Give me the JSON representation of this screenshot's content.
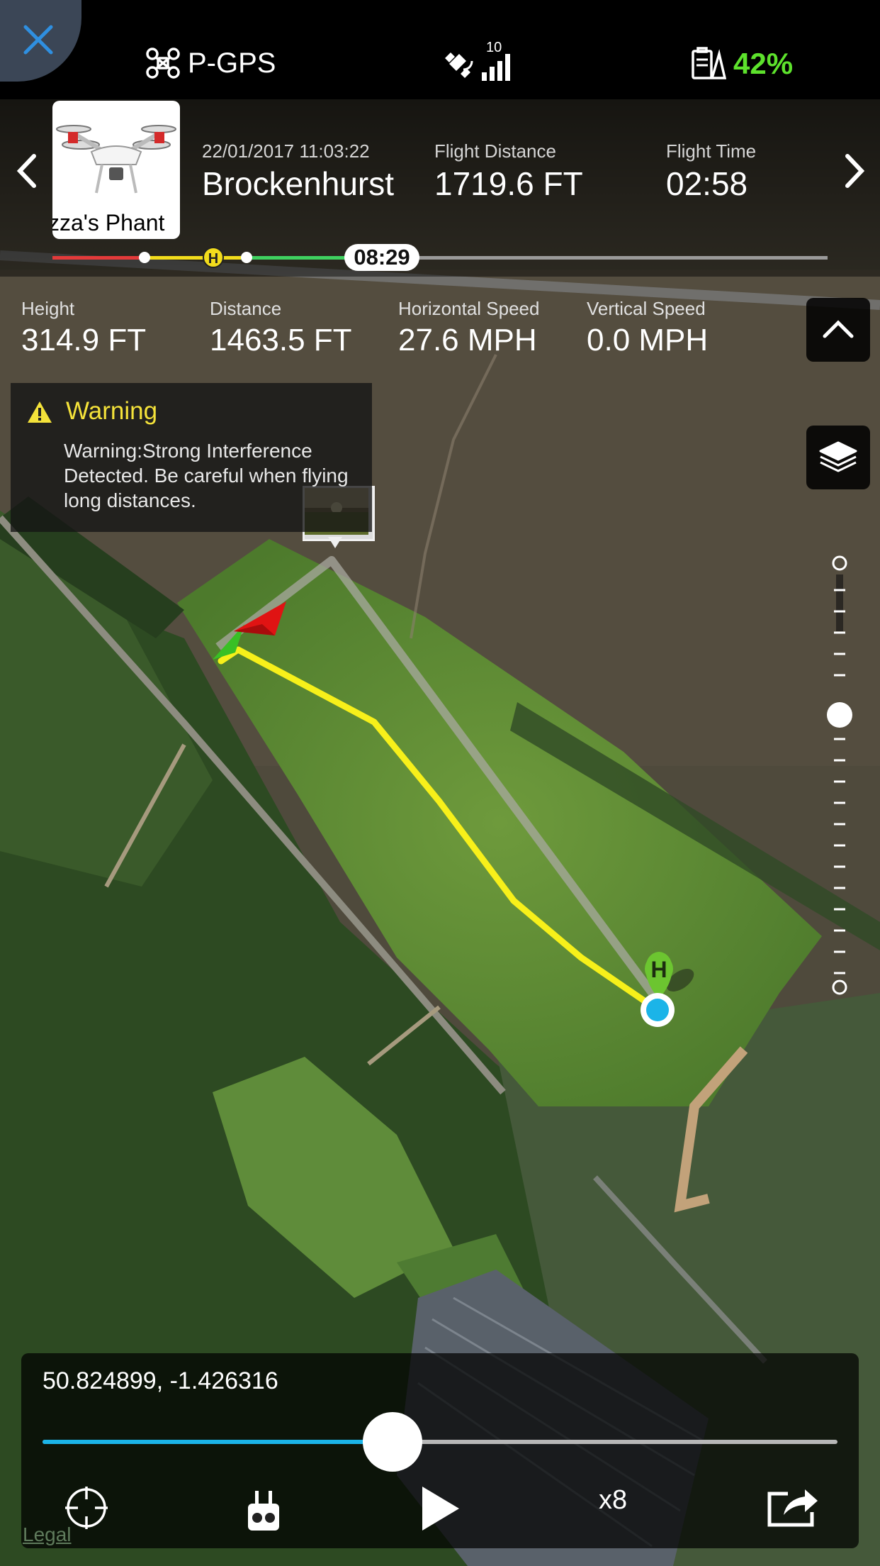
{
  "status": {
    "mode": "P-GPS",
    "satellites": "10",
    "battery": "42%"
  },
  "flight": {
    "aircraft_name": "zza's Phant",
    "datetime": "22/01/2017 11:03:22",
    "location": "Brockenhurst",
    "distance_label": "Flight Distance",
    "distance_value": "1719.6 FT",
    "time_label": "Flight Time",
    "time_value": "02:58",
    "timeline_time": "08:29",
    "home_marker": "H"
  },
  "telemetry": [
    {
      "label": "Height",
      "value": "314.9 FT"
    },
    {
      "label": "Distance",
      "value": "1463.5 FT"
    },
    {
      "label": "Horizontal Speed",
      "value": "27.6 MPH"
    },
    {
      "label": "Vertical Speed",
      "value": "0.0 MPH"
    }
  ],
  "warning": {
    "title": "Warning",
    "text": "Warning:Strong Interference Detected. Be careful when flying long distances."
  },
  "map": {
    "home_label": "H",
    "legal": "Legal"
  },
  "playback": {
    "coords": "50.824899, -1.426316",
    "progress": 0.44,
    "speed": "x8"
  },
  "colors": {
    "battery": "#5de22c",
    "close": "#2f8fe0",
    "accent": "#1bb4e8",
    "path": "#f7f01a",
    "home": "#6cc530"
  },
  "icons": [
    "close-icon",
    "drone-icon",
    "satellite-icon",
    "battery-icon",
    "chevron-left-icon",
    "chevron-right-icon",
    "chevron-up-icon",
    "layers-icon",
    "warning-icon",
    "locate-icon",
    "controller-icon",
    "play-icon",
    "share-icon"
  ]
}
